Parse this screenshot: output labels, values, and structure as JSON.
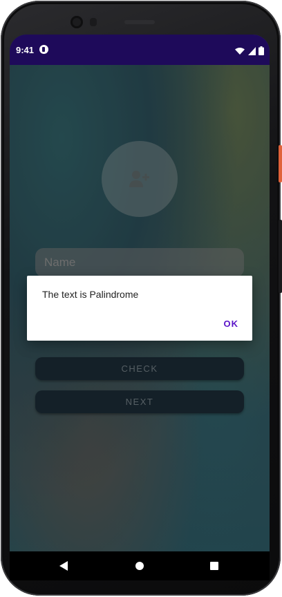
{
  "status_bar": {
    "time": "9:41",
    "app_icon": "notification-app-icon",
    "icons": [
      "wifi-icon",
      "signal-icon",
      "battery-icon"
    ]
  },
  "screen": {
    "avatar_icon": "add-person-icon",
    "name_input": {
      "placeholder": "Name",
      "value": ""
    },
    "buttons": {
      "check_label": "CHECK",
      "next_label": "NEXT"
    }
  },
  "dialog": {
    "message": "The text is Palindrome",
    "ok_label": "OK",
    "accent_color": "#5a14c8"
  },
  "nav_bar": {
    "icons": [
      "back-icon",
      "home-icon",
      "recents-icon"
    ]
  },
  "colors": {
    "status_bar": "#1e0a5a",
    "button_bg": "#1a2a34",
    "button_text": "#6f7a80"
  }
}
